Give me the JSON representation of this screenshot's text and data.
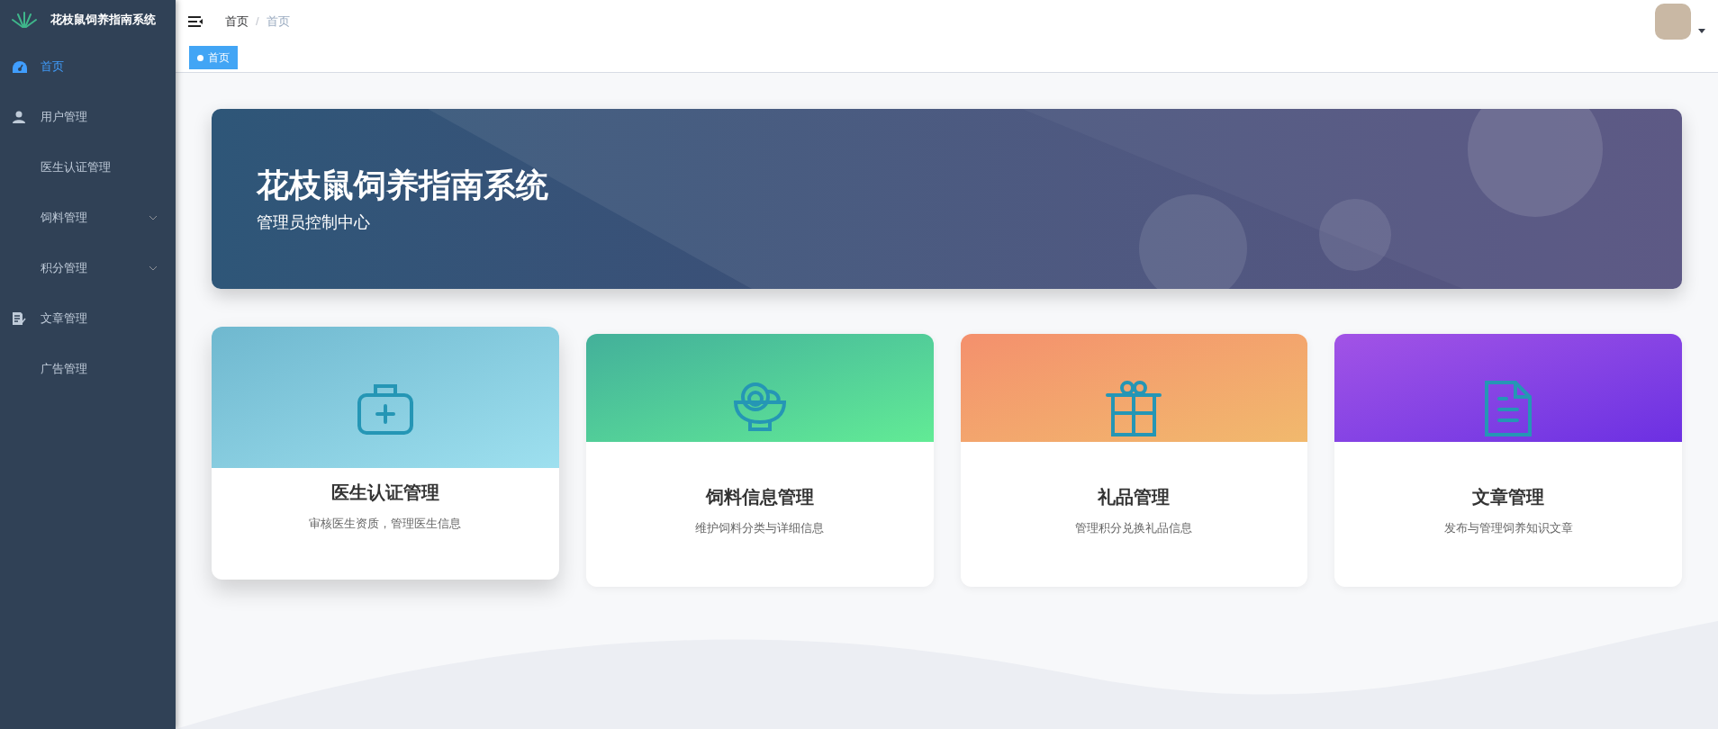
{
  "sidebar": {
    "title": "花枝鼠饲养指南系统",
    "items": [
      {
        "label": "首页",
        "selected": true
      },
      {
        "label": "用户管理",
        "selected": false
      },
      {
        "label": "医生认证管理",
        "selected": false
      },
      {
        "label": "饲料管理",
        "selected": false,
        "expanded": false
      },
      {
        "label": "积分管理",
        "selected": false,
        "expanded": false
      },
      {
        "label": "文章管理",
        "selected": false
      },
      {
        "label": "广告管理",
        "selected": false
      }
    ]
  },
  "breadcrumb": [
    "首页",
    "首页"
  ],
  "breadcrumb_separator": "/",
  "tags": [
    {
      "label": "首页",
      "selected": true
    }
  ],
  "banner": {
    "title": "花枝鼠饲养指南系统",
    "subtitle": "管理员控制中心"
  },
  "cards": [
    {
      "title": "医生认证管理",
      "description": "审核医生资质，管理医生信息",
      "hovered": true
    },
    {
      "title": "饲料信息管理",
      "description": "维护饲料分类与详细信息",
      "hovered": false
    },
    {
      "title": "礼品管理",
      "description": "管理积分兑换礼品信息",
      "hovered": false
    },
    {
      "title": "文章管理",
      "description": "发布与管理饲养知识文章",
      "hovered": false
    }
  ]
}
